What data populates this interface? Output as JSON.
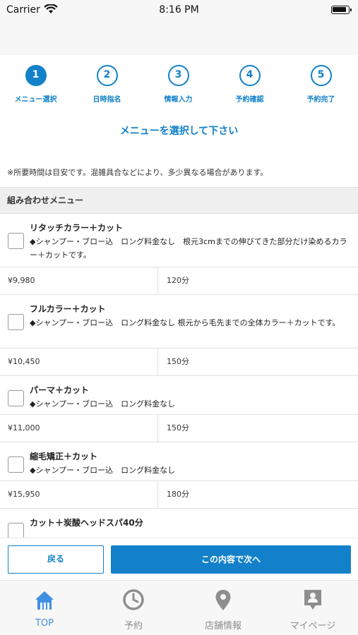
{
  "status_bar": {
    "carrier": "Carrier",
    "time": "8:16 PM"
  },
  "steps": [
    {
      "number": "1",
      "label": "メニュー選択"
    },
    {
      "number": "2",
      "label": "日時指名"
    },
    {
      "number": "3",
      "label": "情報入力"
    },
    {
      "number": "4",
      "label": "予約確認"
    },
    {
      "number": "5",
      "label": "予約完了"
    }
  ],
  "active_step": 1,
  "heading": "メニューを選択して下さい",
  "notice": "※所要時間は目安です。混雑具合などにより、多少異なる場合があります。",
  "section_title": "組み合わせメニュー",
  "menus": [
    {
      "name": "リタッチカラー＋カット",
      "description": "◆シャンプー・ブロー込　ロング料金なし　根元3cmまでの伸びてきた部分だけ染めるカラー＋カットです。",
      "price": "¥9,980",
      "duration": "120分",
      "checked": false
    },
    {
      "name": "フルカラー＋カット",
      "description": "◆シャンプー・ブロー込　ロング料金なし  根元から毛先までの全体カラー＋カットです。",
      "price": "¥10,450",
      "duration": "150分",
      "checked": false
    },
    {
      "name": "パーマ＋カット",
      "description": "◆シャンプー・ブロー込　ロング料金なし",
      "price": "¥11,000",
      "duration": "150分",
      "checked": false
    },
    {
      "name": "縮毛矯正＋カット",
      "description": "◆シャンプー・ブロー込　ロング料金なし",
      "price": "¥15,950",
      "duration": "180分",
      "checked": false
    },
    {
      "name": "カット＋炭酸ヘッドスパ40分",
      "checked": false
    }
  ],
  "buttons": {
    "back": "戻る",
    "next": "この内容で次へ"
  },
  "tabs": [
    {
      "label": "TOP",
      "icon": "home-icon"
    },
    {
      "label": "予約",
      "icon": "clock-icon"
    },
    {
      "label": "店舗情報",
      "icon": "location-pin-icon"
    },
    {
      "label": "マイページ",
      "icon": "profile-icon"
    }
  ],
  "active_tab": "TOP",
  "colors": {
    "accent": "#1281c9",
    "tab_active": "#3f8fe0",
    "tab_inactive": "#8e8e8e"
  }
}
